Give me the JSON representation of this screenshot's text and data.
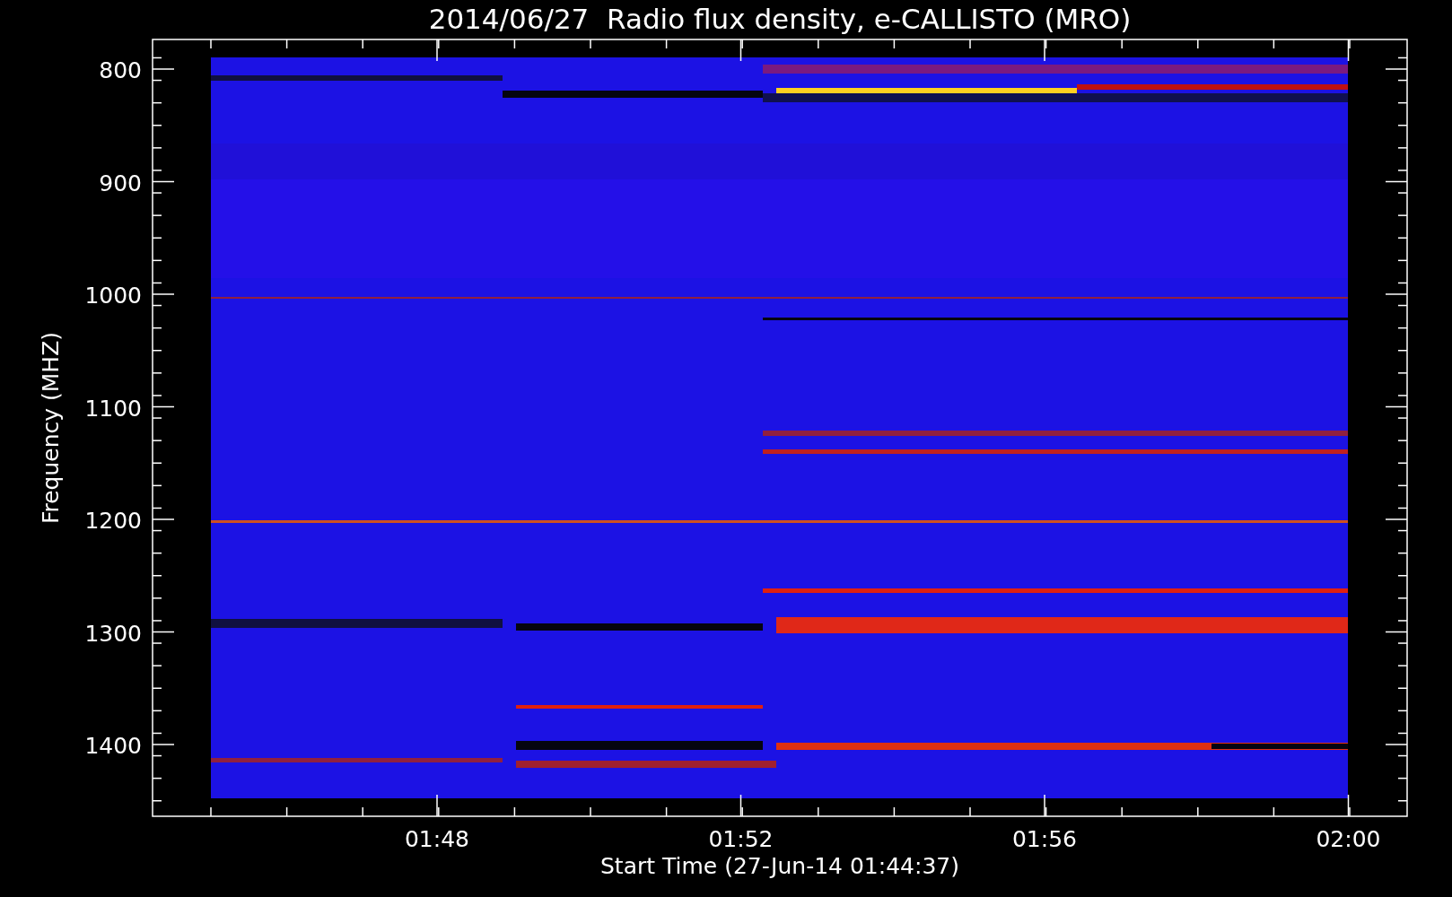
{
  "title": "2014/06/27  Radio flux density, e-CALLISTO (MRO)",
  "y_axis": {
    "label": "Frequency (MHZ)",
    "ticks": [
      "800",
      "900",
      "1000",
      "1100",
      "1200",
      "1300",
      "1400"
    ]
  },
  "x_axis": {
    "label": "Start Time (27-Jun-14 01:44:37)",
    "ticks": [
      "01:48",
      "01:52",
      "01:56",
      "02:00"
    ]
  }
}
